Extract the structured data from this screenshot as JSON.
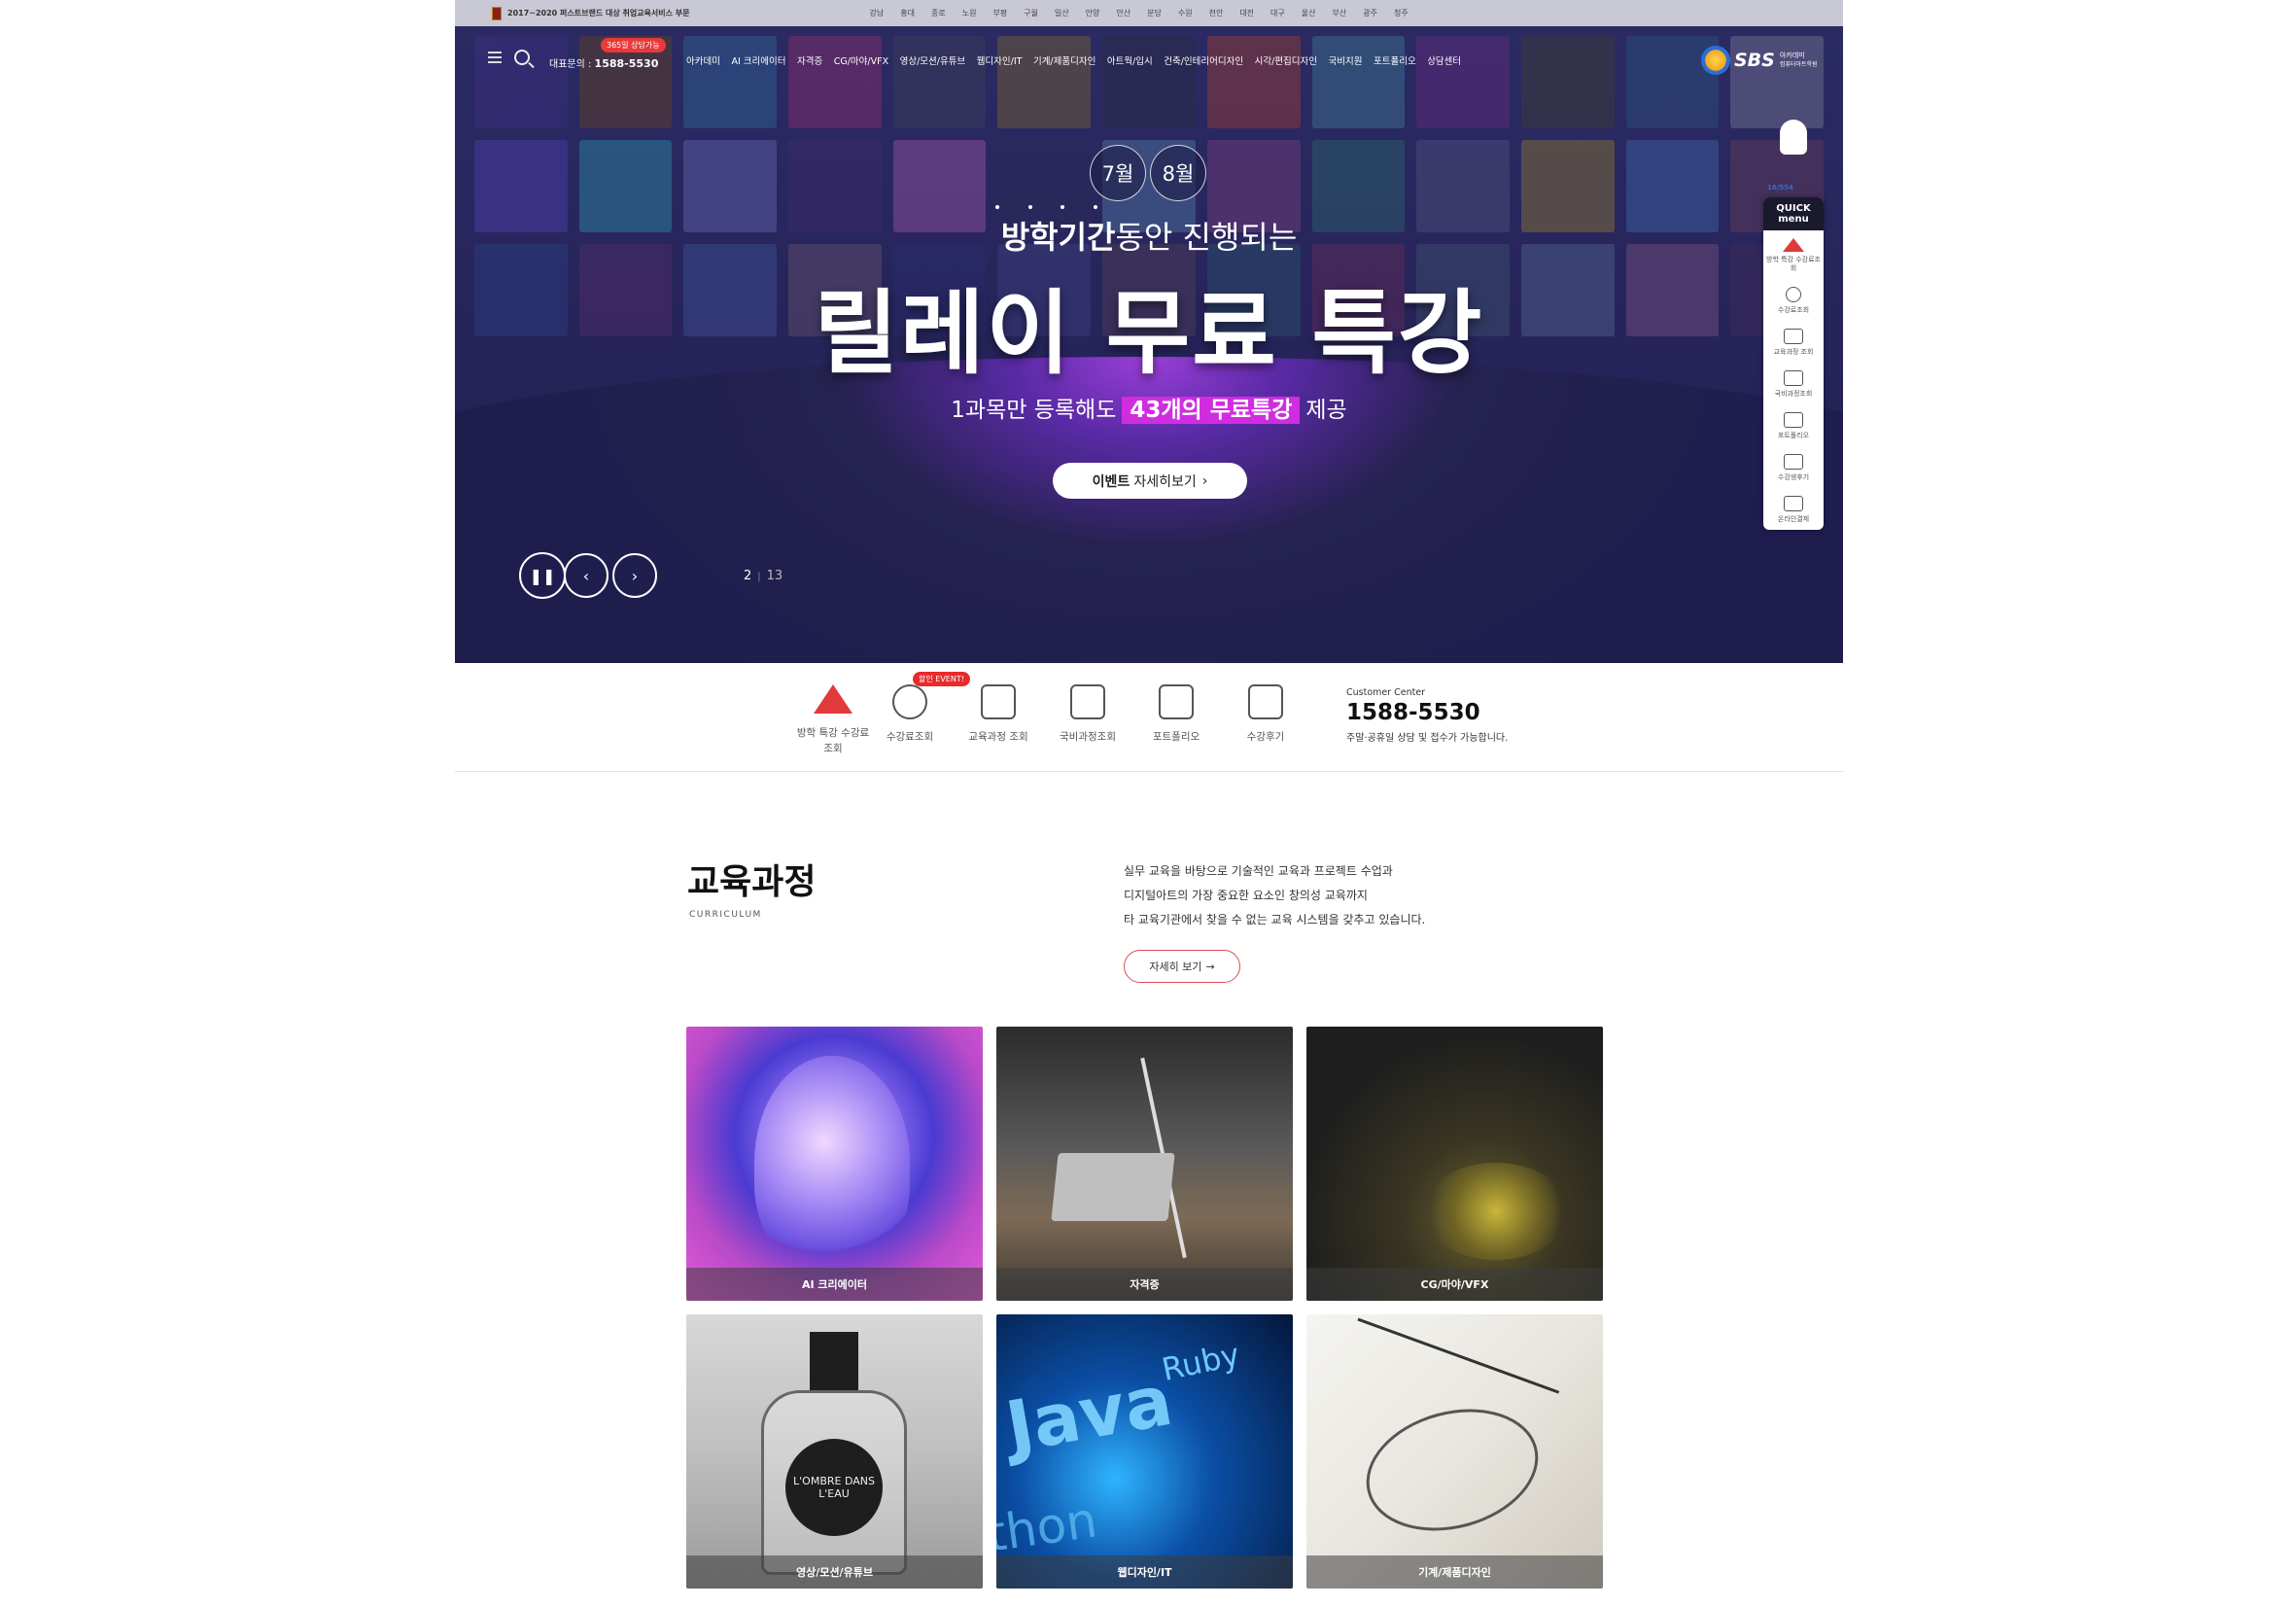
{
  "topbar": {
    "award": "2017~2020 퍼스트브랜드 대상 취업교육서비스 부문",
    "branches": [
      "강남",
      "홍대",
      "종로",
      "노원",
      "부평",
      "구월",
      "일산",
      "안양",
      "안산",
      "분당",
      "수원",
      "천안",
      "대전",
      "대구",
      "울산",
      "부산",
      "광주",
      "청주"
    ]
  },
  "nav": {
    "consult_badge": "365일 상담가능",
    "phone_label": "대표문의 :",
    "phone": "1588-5530",
    "items": [
      "아카데미",
      "AI 크리에이터",
      "자격증",
      "CG/마야/VFX",
      "영상/모션/유튜브",
      "웹디자인/IT",
      "기계/제품디자인",
      "아트웍/입시",
      "건축/인테리어디자인",
      "시각/편집디자인",
      "국비지원",
      "포트폴리오",
      "상담센터"
    ],
    "logo_text": "SBS",
    "logo_sub": "아카데미",
    "logo_sub2": "컴퓨터아트학원"
  },
  "hero": {
    "month1": "7월",
    "month2": "8월",
    "sub_head_bold": "방학기간",
    "sub_head_rest": "동안 진행되는",
    "headline": "릴레이 무료 특강",
    "desc_pre": "1과목만 등록해도",
    "desc_highlight": "43개의 무료특강",
    "desc_post": "제공",
    "cta_bold": "이벤트",
    "cta_rest": "자세히보기",
    "pager_current": "2",
    "pager_total": "13"
  },
  "quick": {
    "label_top": "16/554",
    "title": "QUICK menu",
    "items": [
      "방학 특강 수강료조회",
      "수강료조회",
      "교육과정 조회",
      "국비과정조회",
      "포트폴리오",
      "수강생후기",
      "온라인결제"
    ]
  },
  "iconrow": {
    "event_badge": "할인 EVENT!",
    "items": [
      "방학 특강 수강료조회",
      "수강료조회",
      "교육과정 조회",
      "국비과정조회",
      "포트폴리오",
      "수강후기"
    ],
    "cc_label": "Customer Center",
    "cc_phone": "1588-5530",
    "cc_note": "주말·공휴일 상담 및 접수가 가능합니다."
  },
  "curriculum": {
    "title": "교육과정",
    "eng": "CURRICULUM",
    "desc": [
      "실무 교육을 바탕으로 기술적인 교육과 프로젝트 수업과",
      "디지털아트의 가장 중요한 요소인 창의성 교육까지",
      "타 교육기관에서 찾을 수 없는 교육 시스템을 갖추고 있습니다."
    ],
    "more": "자세히 보기",
    "cards": [
      "AI 크리에이터",
      "자격증",
      "CG/마야/VFX",
      "영상/모션/유튜브",
      "웹디자인/IT",
      "기계/제품디자인"
    ],
    "bottle_label": "L'OMBRE DANS L'EAU",
    "java_text": "Java",
    "ruby_text": "Ruby",
    "thon_text": "thon"
  }
}
